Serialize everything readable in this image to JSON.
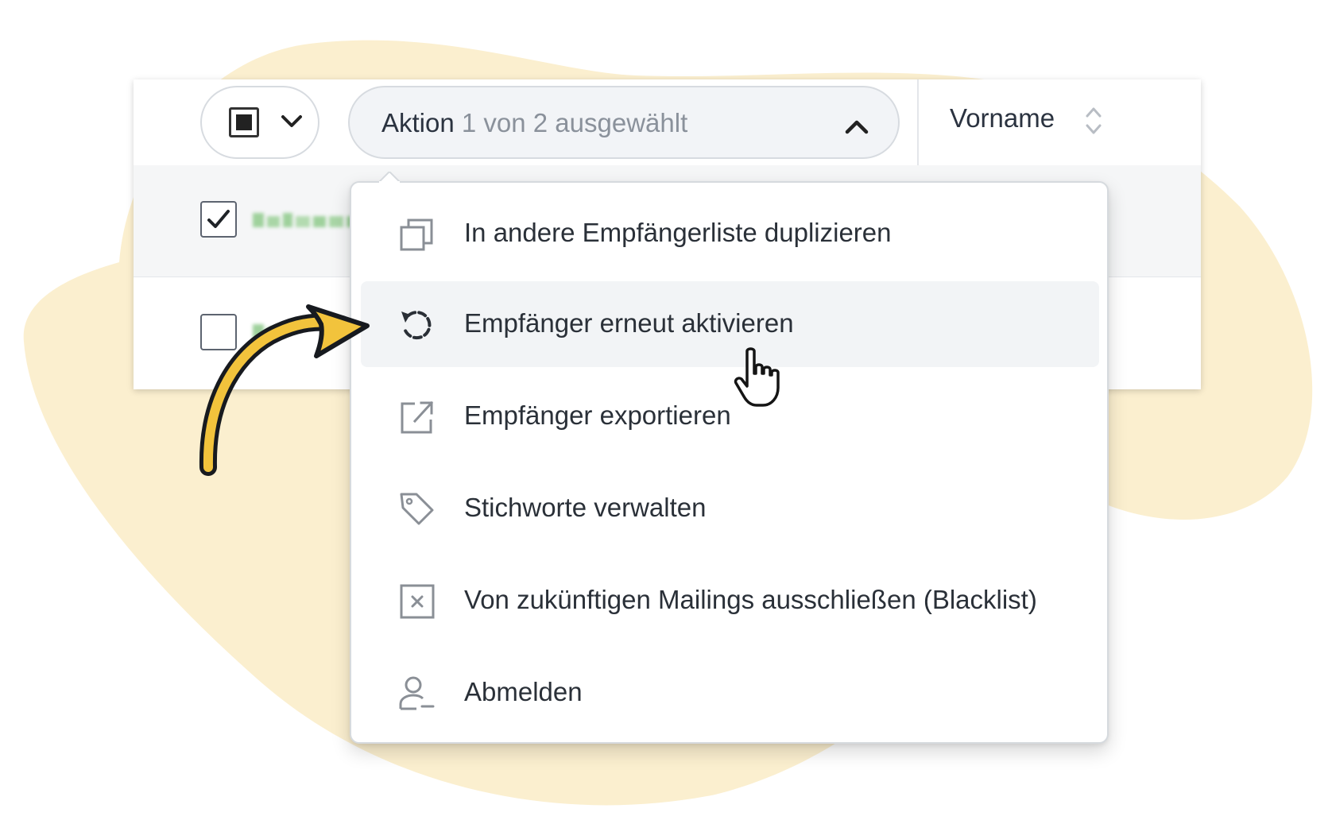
{
  "colors": {
    "blob": "#fbefcf",
    "arrow_fill": "#f2c33c",
    "arrow_stroke": "#171a1f",
    "menu_highlight": "#f2f4f6",
    "blurred_text": "#9fd19c"
  },
  "toolbar": {
    "select_icon": "filled-square-checkbox-icon",
    "action_label": "Aktion",
    "action_count": "1 von 2 ausgewählt"
  },
  "table": {
    "columns": [
      {
        "label": "Vorname",
        "sort_icon": "sort-arrows-icon"
      }
    ],
    "rows": [
      {
        "checked": true
      },
      {
        "checked": false
      }
    ]
  },
  "menu": {
    "items": [
      {
        "label": "In andere Empfängerliste duplizieren",
        "icon": "duplicate-icon",
        "highlighted": false
      },
      {
        "label": "Empfänger erneut aktivieren",
        "icon": "reactivate-icon",
        "highlighted": true
      },
      {
        "label": "Empfänger exportieren",
        "icon": "export-icon",
        "highlighted": false
      },
      {
        "label": "Stichworte verwalten",
        "icon": "tag-icon",
        "highlighted": false
      },
      {
        "label": "Von zukünftigen Mailings ausschließen (Blacklist)",
        "icon": "blacklist-icon",
        "highlighted": false
      },
      {
        "label": "Abmelden",
        "icon": "unsubscribe-user-icon",
        "highlighted": false
      }
    ]
  },
  "cursor_icon": "hand-pointer-icon",
  "annotation_icon": "curved-arrow-icon"
}
